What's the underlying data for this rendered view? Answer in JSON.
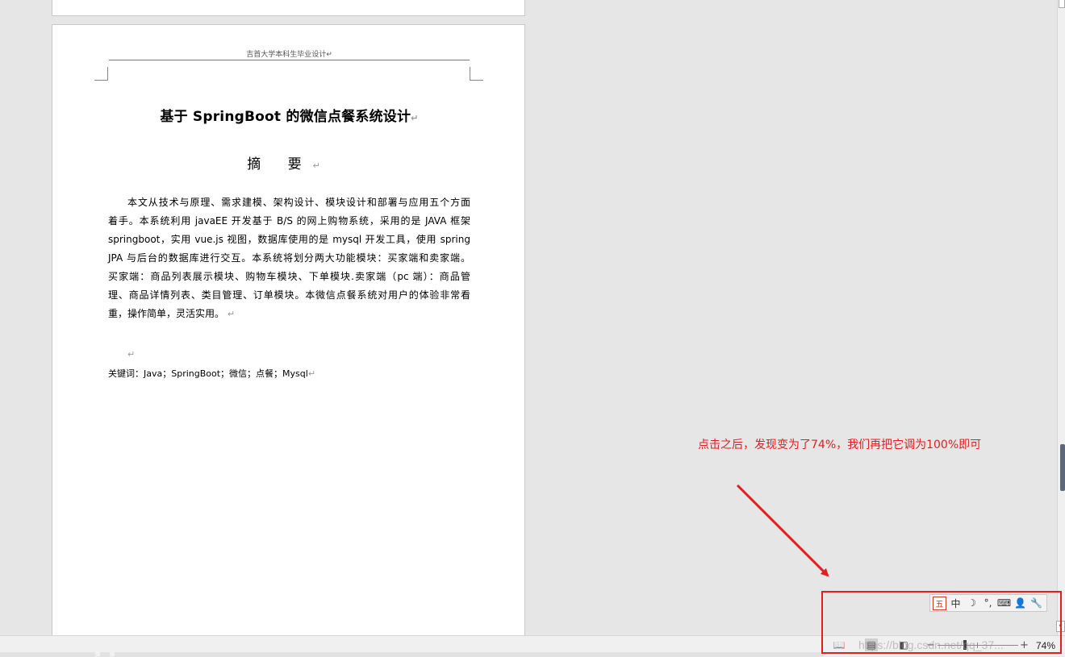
{
  "document": {
    "header_text": "吉首大学本科生毕业设计↵",
    "title": "基于 SpringBoot 的微信点餐系统设计",
    "abstract_heading": "摘 要",
    "paragraph_mark": "↵",
    "abstract_lines": [
      "本文从技术与原理、需求建模、架构设计、模块设计和部署与应用五个方面",
      "着手。本系统利用 javaEE 开发基于 B/S 的网上购物系统，采用的是 JAVA 框架",
      "springboot，实用 vue.js 视图，数据库使用的是 mysql 开发工具，使用 spring",
      "JPA 与后台的数据库进行交互。本系统将划分两大功能模块：买家端和卖家端。",
      "买家端：商品列表展示模块、购物车模块、下单模块.卖家端（pc 端）：商品管",
      "理、商品详情列表、类目管理、订单模块。本微信点餐系统对用户的体验非常看",
      "重，操作简单，灵活实用。"
    ],
    "keywords": "关键词：Java；SpringBoot；微信；点餐；Mysql"
  },
  "annotation": {
    "text": "点击之后，发现变为了74%，我们再把它调为100%即可",
    "color": "#e02020"
  },
  "ime_toolbar": {
    "items": [
      {
        "name": "ime-logo-icon",
        "glyph": "五"
      },
      {
        "name": "ime-chinese-mode",
        "glyph": "中"
      },
      {
        "name": "ime-halfwidth-moon-icon",
        "glyph": "☽"
      },
      {
        "name": "ime-punctuation-icon",
        "glyph": "°,"
      },
      {
        "name": "ime-keyboard-icon",
        "glyph": "⌨"
      },
      {
        "name": "ime-user-icon",
        "glyph": "👤"
      },
      {
        "name": "ime-settings-wrench-icon",
        "glyph": "🔧"
      }
    ]
  },
  "statusbar": {
    "watermark": "https://blog.csdn.net/qq_37...",
    "zoom_level": "74%",
    "zoom_minus": "−",
    "zoom_plus": "+",
    "view_icons": [
      {
        "name": "reading-view-icon",
        "glyph": "📖"
      },
      {
        "name": "print-layout-icon",
        "glyph": "▤"
      },
      {
        "name": "web-layout-icon",
        "glyph": "◧"
      }
    ]
  }
}
